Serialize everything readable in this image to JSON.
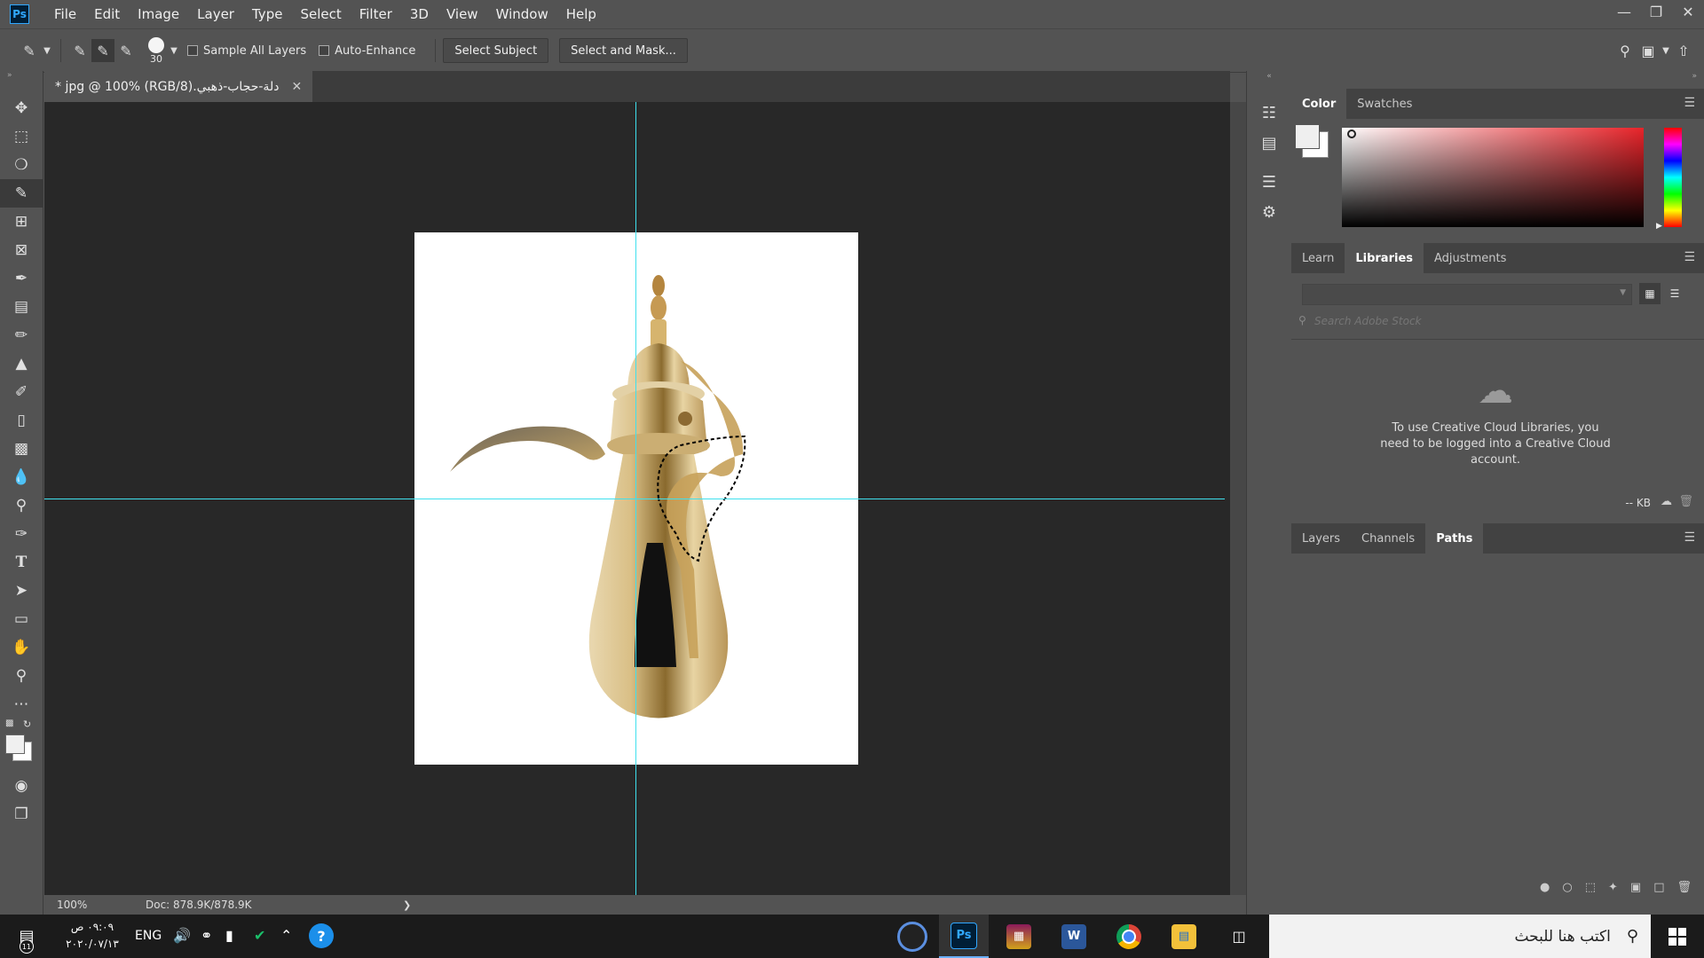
{
  "menubar": {
    "logo": "Ps",
    "items": [
      "File",
      "Edit",
      "Image",
      "Layer",
      "Type",
      "Select",
      "Filter",
      "3D",
      "View",
      "Window",
      "Help"
    ]
  },
  "options": {
    "brush_size": "30",
    "sample_all_layers": "Sample All Layers",
    "auto_enhance": "Auto-Enhance",
    "select_subject": "Select Subject",
    "select_and_mask": "Select and Mask..."
  },
  "document": {
    "tab_title": "دلة-حجاب-ذهبي.jpg @ 100% (RGB/8) *",
    "zoom": "100%",
    "doc_info": "Doc: 878.9K/878.9K"
  },
  "color_panel": {
    "tabs": [
      "Color",
      "Swatches"
    ],
    "active_tab": "Color"
  },
  "libraries_panel": {
    "tabs": [
      "Learn",
      "Libraries",
      "Adjustments"
    ],
    "active_tab": "Libraries",
    "search_placeholder": "Search Adobe Stock",
    "message": "To use Creative Cloud Libraries, you need to be logged into a Creative Cloud account.",
    "size": "-- KB"
  },
  "layers_panel": {
    "tabs": [
      "Layers",
      "Channels",
      "Paths"
    ],
    "active_tab": "Paths"
  },
  "taskbar": {
    "time": "٠٩:٠٩ ص",
    "date": "٢٠٢٠/٠٧/١٣",
    "language": "ENG",
    "search_placeholder": "اكتب هنا للبحث",
    "notification_count": "11"
  },
  "colors": {
    "ui_bg": "#535353",
    "canvas_bg": "#282828",
    "guide": "#3fe0ee",
    "ps_blue": "#31a8ff"
  }
}
